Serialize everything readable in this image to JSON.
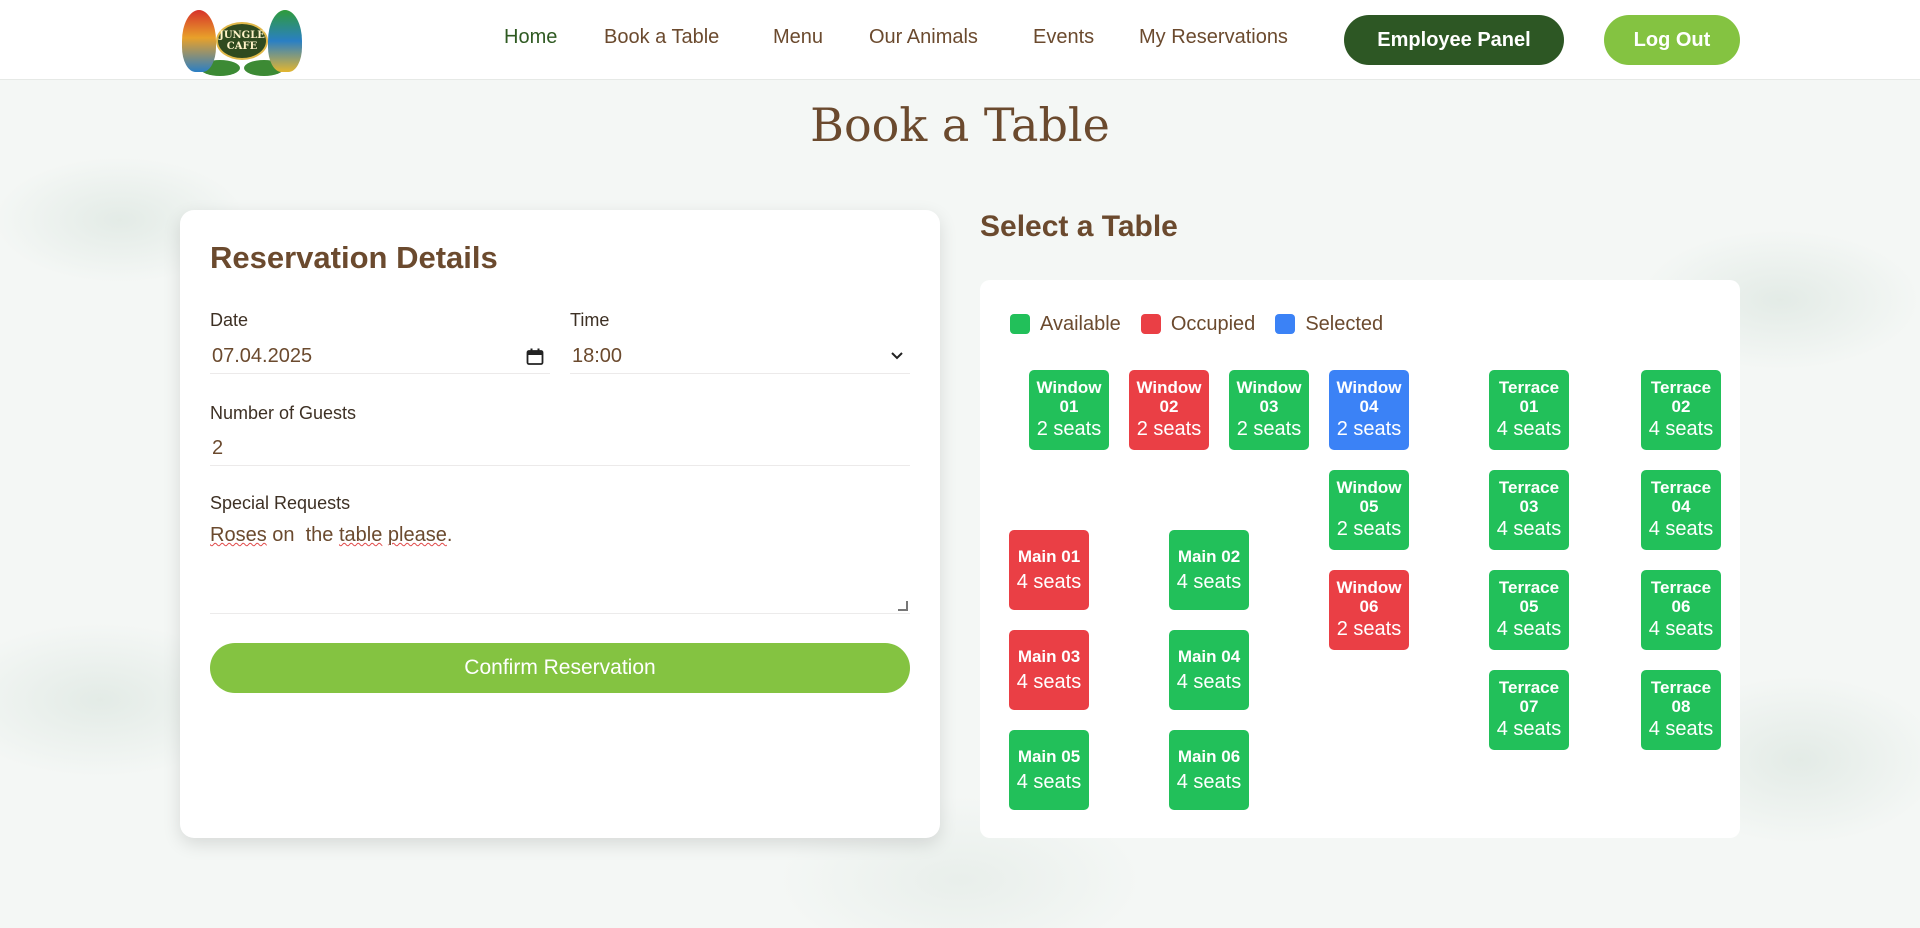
{
  "navbar": {
    "logo_text": "JUNGLE CAFE",
    "links": [
      "Home",
      "Book a Table",
      "Menu",
      "Our Animals",
      "Events",
      "My Reservations"
    ],
    "employee_button": "Employee Panel",
    "logout_button": "Log Out"
  },
  "page": {
    "title": "Book a Table"
  },
  "form": {
    "title": "Reservation Details",
    "date_label": "Date",
    "date_value": "07.04.2025",
    "time_label": "Time",
    "time_value": "18:00",
    "guests_label": "Number of Guests",
    "guests_value": "2",
    "requests_label": "Special Requests",
    "requests_value": [
      "Roses",
      " on  the ",
      "table",
      " ",
      "please",
      "."
    ],
    "confirm_button": "Confirm Reservation"
  },
  "tables_section": {
    "title": "Select a Table",
    "legend": [
      {
        "label": "Available",
        "color": "#22c05a"
      },
      {
        "label": "Occupied",
        "color": "#ea3f45"
      },
      {
        "label": "Selected",
        "color": "#3b82f6"
      }
    ],
    "tables": [
      {
        "name": "Window 01",
        "seats": "2 seats",
        "status": "available"
      },
      {
        "name": "Window 02",
        "seats": "2 seats",
        "status": "occupied"
      },
      {
        "name": "Window 03",
        "seats": "2 seats",
        "status": "available"
      },
      {
        "name": "Window 04",
        "seats": "2 seats",
        "status": "selected"
      },
      {
        "name": "Window 05",
        "seats": "2 seats",
        "status": "available"
      },
      {
        "name": "Window 06",
        "seats": "2 seats",
        "status": "occupied"
      },
      {
        "name": "Main 01",
        "seats": "4 seats",
        "status": "occupied"
      },
      {
        "name": "Main 02",
        "seats": "4 seats",
        "status": "available"
      },
      {
        "name": "Main 03",
        "seats": "4 seats",
        "status": "occupied"
      },
      {
        "name": "Main 04",
        "seats": "4 seats",
        "status": "available"
      },
      {
        "name": "Main 05",
        "seats": "4 seats",
        "status": "available"
      },
      {
        "name": "Main 06",
        "seats": "4 seats",
        "status": "available"
      },
      {
        "name": "Terrace 01",
        "seats": "4 seats",
        "status": "available"
      },
      {
        "name": "Terrace 02",
        "seats": "4 seats",
        "status": "available"
      },
      {
        "name": "Terrace 03",
        "seats": "4 seats",
        "status": "available"
      },
      {
        "name": "Terrace 04",
        "seats": "4 seats",
        "status": "available"
      },
      {
        "name": "Terrace 05",
        "seats": "4 seats",
        "status": "available"
      },
      {
        "name": "Terrace 06",
        "seats": "4 seats",
        "status": "available"
      },
      {
        "name": "Terrace 07",
        "seats": "4 seats",
        "status": "available"
      },
      {
        "name": "Terrace 08",
        "seats": "4 seats",
        "status": "available"
      }
    ]
  }
}
